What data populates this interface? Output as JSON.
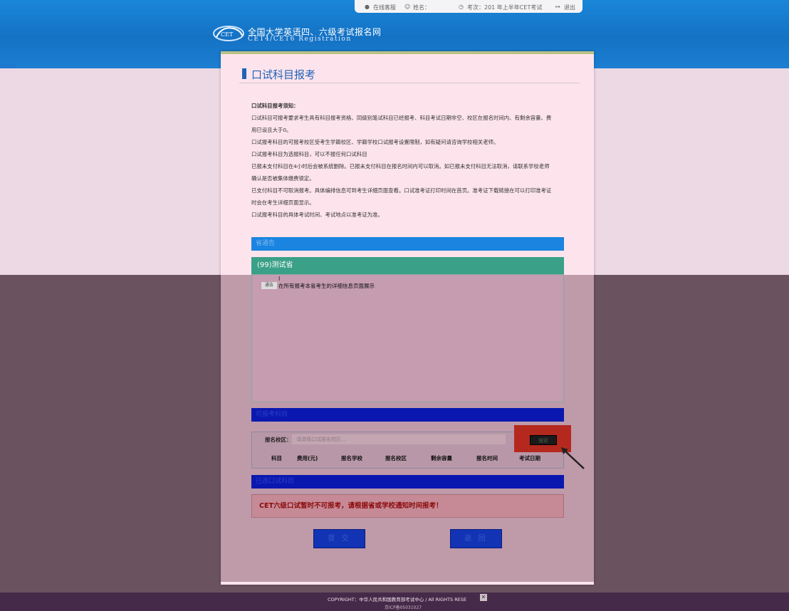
{
  "topbar": {
    "service_label": "在线客服",
    "name_label": "姓名：",
    "exam_label": "考次：201  年上半年CET考试",
    "logout_label": "退出"
  },
  "header": {
    "site_title": "全国大学英语四、六级考试报名网",
    "site_subtitle": "CET4/CET6  Registration"
  },
  "page": {
    "title": "口试科目报考"
  },
  "notice": {
    "heading": "口试科目报考须知：",
    "lines": [
      "口试科目可报考要求考生具有科目报考资格、同级别笔试科目已经报考、科目考试日期非空、校区在报名时间内、有剩余容量、费",
      "用已设且大于0。",
      "口试报考科目的可报考校区受考生学籍校区、学籍学校口试报考设置限制，如有疑问请咨询学校相关老师。",
      "口试报考科目为选报科目，可以不报任何口试科目",
      "已报未支付科目在4小时后会被系统删除。已报未支付科目在报名时间内可以取消。如已报未支付科目无法取消，请联系学校老师",
      "确认是否被集体缴费锁定。",
      "已支付科目不可取消报考。具体编排信息可到考生详细页面查看。口试准考证打印时间在首页。准考证下载链接在可以打印准考证",
      "时会在考生详细页面显示。",
      "口试报考科目的具体考试时间、考试地点以准考证为准。"
    ]
  },
  "province_notice": {
    "section_label": "省通告",
    "province_name": "(99)测试省",
    "tag": "通告",
    "text": "在所有报考本省考生的详细信息页面展示"
  },
  "campus_section": {
    "section_label": "可报考科目",
    "field_label": "报名校区：",
    "placeholder": "请选择口试报名校区...",
    "search_label": "搜索",
    "columns": [
      "科目",
      "费用(元)",
      "报名学校",
      "报名校区",
      "剩余容量",
      "报名时间",
      "考试日期"
    ]
  },
  "selected_section": {
    "section_label": "已选口试科目"
  },
  "warning": {
    "text": "CET六级口试暂时不可报考，请根据省或学校通知时间报考！"
  },
  "actions": {
    "submit_label": "提 交",
    "back_label": "返 回"
  },
  "footer": {
    "copyright": "COPYRIGHT：中华人民共和国教育部考试中心 / All RIGHTS RESE",
    "icp": "京ICP备05031027"
  }
}
